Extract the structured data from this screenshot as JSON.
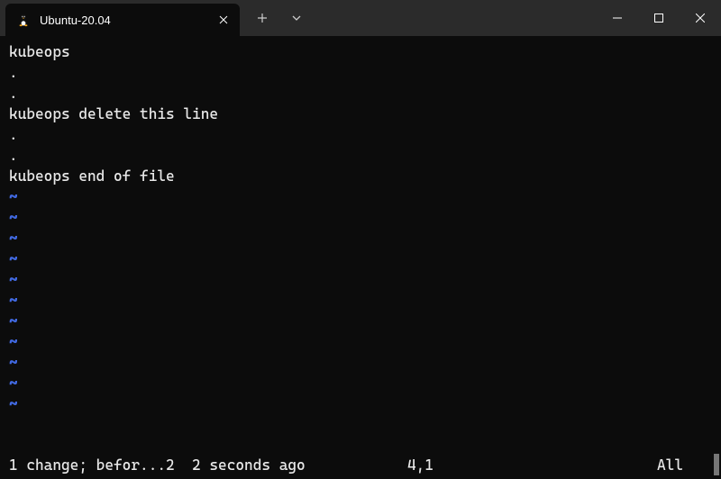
{
  "tab": {
    "title": "Ubuntu-20.04"
  },
  "editor": {
    "lines": [
      "kubeops",
      ".",
      ".",
      "kubeops delete this line",
      ".",
      ".",
      "kubeops end of file"
    ],
    "tilde": "~",
    "tilde_count": 11
  },
  "status": {
    "message": "1 change; befor...2  2 seconds ago",
    "position": "4,1",
    "percent": "All"
  }
}
